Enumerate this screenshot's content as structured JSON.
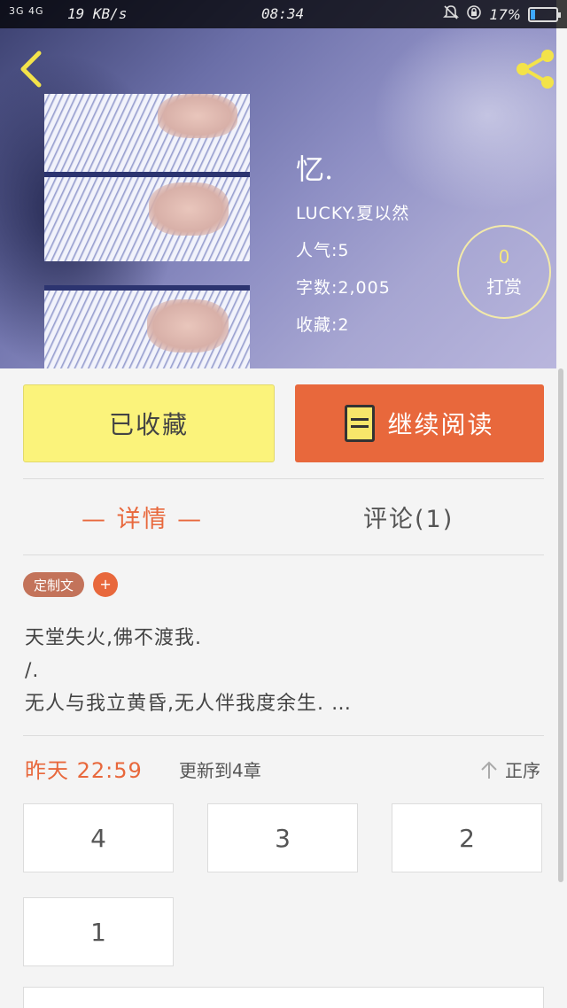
{
  "status_bar": {
    "signal": "3G 4G",
    "speed": "19 KB/s",
    "time": "08:34",
    "battery": "17%",
    "battery_level": 0.17
  },
  "header": {
    "back_icon": "chevron-left-icon",
    "share_icon": "share-icon"
  },
  "book": {
    "title": "忆.",
    "author": "LUCKY.夏以然",
    "popularity": "人气:5",
    "word_count": "字数:2,005",
    "favorites": "收藏:2"
  },
  "reward": {
    "count": "0",
    "label": "打赏"
  },
  "actions": {
    "favorited_label": "已收藏",
    "continue_label": "继续阅读"
  },
  "tabs": {
    "details": "— 详情 —",
    "comments": "评论(1)"
  },
  "tags": {
    "custom": "定制文",
    "add": "+"
  },
  "description": {
    "line1": "天堂失火,佛不渡我.",
    "line2": "/.",
    "line3": "无人与我立黄昏,无人伴我度余生. …"
  },
  "update": {
    "when": "昨天 22:59",
    "to": "更新到4章",
    "sort_label": "正序"
  },
  "chapters": [
    "4",
    "3",
    "2",
    "1"
  ],
  "colors": {
    "accent": "#e8683c",
    "favorite_bg": "#fbf37b",
    "reward_count": "#f6e87a"
  }
}
